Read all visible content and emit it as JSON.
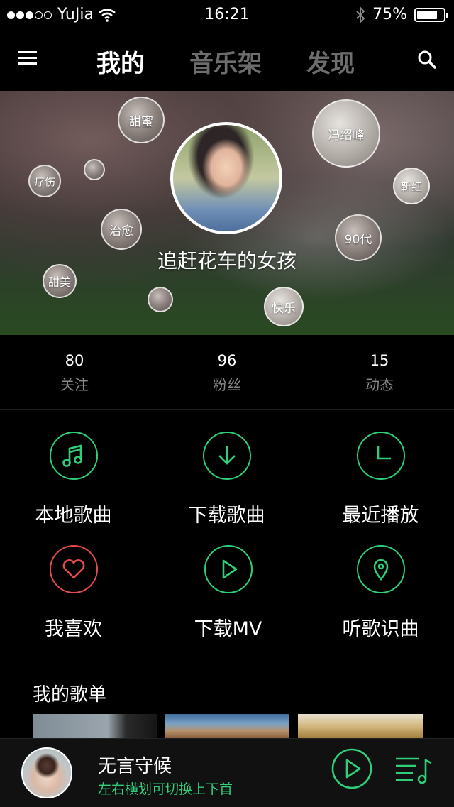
{
  "status_bar": {
    "carrier": "YuJia",
    "time": "16:21",
    "battery": "75%",
    "signal_dots_full": 3,
    "signal_dots_empty": 2
  },
  "nav": {
    "tabs": [
      {
        "label": "我的",
        "active": true
      },
      {
        "label": "音乐架",
        "active": false
      },
      {
        "label": "发现",
        "active": false
      }
    ]
  },
  "profile": {
    "name": "追赶花车的女孩",
    "tags": [
      "甜蜜",
      "冯绍峰",
      "疗伤",
      "靳红",
      "治愈",
      "90代",
      "甜美",
      "快乐"
    ]
  },
  "stats": [
    {
      "value": "80",
      "label": "关注"
    },
    {
      "value": "96",
      "label": "粉丝"
    },
    {
      "value": "15",
      "label": "动态"
    }
  ],
  "features": [
    {
      "label": "本地歌曲",
      "icon": "music-note-icon"
    },
    {
      "label": "下载歌曲",
      "icon": "download-icon"
    },
    {
      "label": "最近播放",
      "icon": "clock-icon"
    },
    {
      "label": "我喜欢",
      "icon": "heart-icon"
    },
    {
      "label": "下载MV",
      "icon": "play-icon"
    },
    {
      "label": "听歌识曲",
      "icon": "location-pin-icon"
    }
  ],
  "playlists": {
    "title": "我的歌单"
  },
  "player": {
    "song": "无言守候",
    "hint": "左右横划可切换上下首"
  },
  "colors": {
    "accent": "#2fcf7a",
    "heart": "#e24b4b",
    "background": "#000000",
    "muted": "#6d6d6d"
  }
}
